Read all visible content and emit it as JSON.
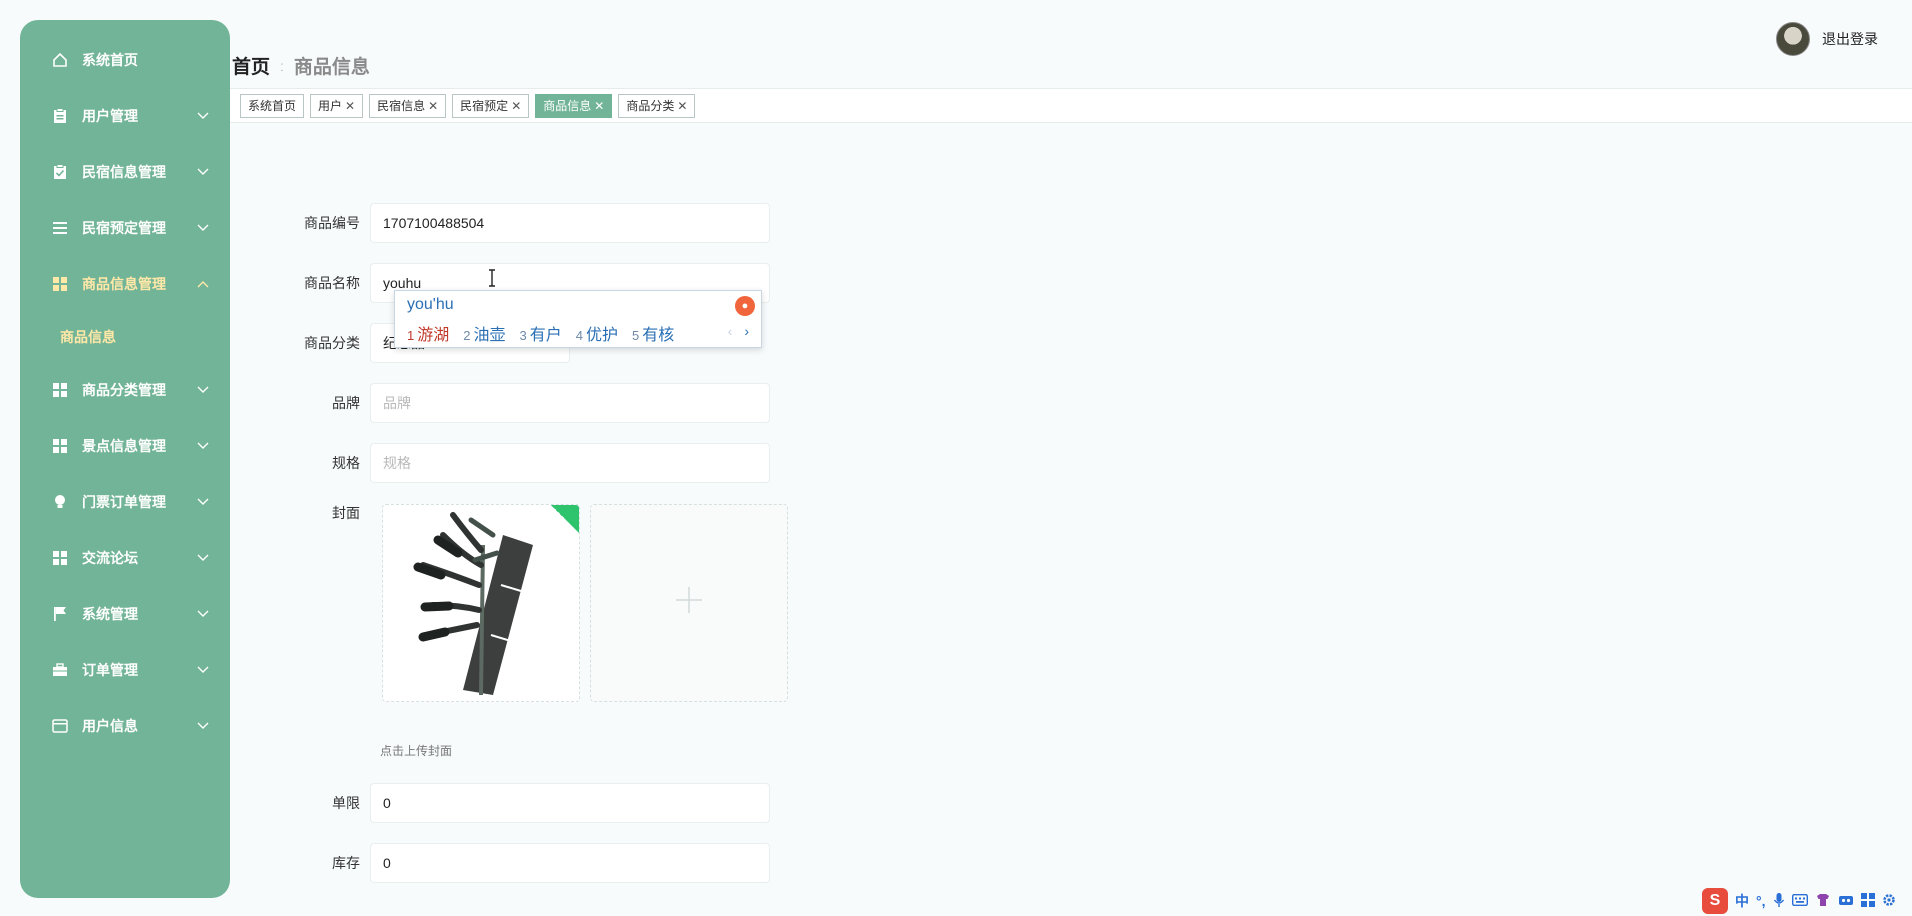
{
  "sidebar": {
    "items": [
      {
        "label": "系统首页",
        "icon": "home-icon",
        "has_children": false
      },
      {
        "label": "用户管理",
        "icon": "clipboard-icon",
        "has_children": true
      },
      {
        "label": "民宿信息管理",
        "icon": "clipboard-check-icon",
        "has_children": true
      },
      {
        "label": "民宿预定管理",
        "icon": "list-icon",
        "has_children": true
      },
      {
        "label": "商品信息管理",
        "icon": "grid-icon",
        "has_children": true,
        "expanded": true
      },
      {
        "label": "商品分类管理",
        "icon": "grid-icon",
        "has_children": true
      },
      {
        "label": "景点信息管理",
        "icon": "grid-icon",
        "has_children": true
      },
      {
        "label": "门票订单管理",
        "icon": "bulb-icon",
        "has_children": true
      },
      {
        "label": "交流论坛",
        "icon": "grid-icon",
        "has_children": true
      },
      {
        "label": "系统管理",
        "icon": "flag-icon",
        "has_children": true
      },
      {
        "label": "订单管理",
        "icon": "briefcase-icon",
        "has_children": true
      },
      {
        "label": "用户信息",
        "icon": "card-icon",
        "has_children": true
      }
    ],
    "submenu": {
      "label": "商品信息"
    }
  },
  "breadcrumb": {
    "home": "首页",
    "separator": "ː",
    "current": "商品信息"
  },
  "header": {
    "logout": "退出登录"
  },
  "tabs": [
    {
      "label": "系统首页",
      "closable": false,
      "active": false
    },
    {
      "label": "用户",
      "closable": true,
      "active": false
    },
    {
      "label": "民宿信息",
      "closable": true,
      "active": false
    },
    {
      "label": "民宿预定",
      "closable": true,
      "active": false
    },
    {
      "label": "商品信息",
      "closable": true,
      "active": true
    },
    {
      "label": "商品分类",
      "closable": true,
      "active": false
    }
  ],
  "tab_close": "✕",
  "form": {
    "code_label": "商品编号",
    "code_value": "1707100488504",
    "name_label": "商品名称",
    "name_value": "youhu",
    "category_label": "商品分类",
    "category_value": "纪念品",
    "brand_label": "品牌",
    "brand_placeholder": "品牌",
    "spec_label": "规格",
    "spec_placeholder": "规格",
    "cover_label": "封面",
    "cover_hint": "点击上传封面",
    "limit_label": "单限",
    "limit_value": "0",
    "stock_label": "库存",
    "stock_value": "0"
  },
  "ime": {
    "composition": "you'hu",
    "candidates": [
      {
        "num": "1",
        "text": "游湖"
      },
      {
        "num": "2",
        "text": "油壶"
      },
      {
        "num": "3",
        "text": "有户"
      },
      {
        "num": "4",
        "text": "优护"
      },
      {
        "num": "5",
        "text": "有核"
      }
    ],
    "prev": "‹",
    "next": "›"
  },
  "tray": {
    "logo": "S",
    "lang": "中",
    "punct": "°,"
  },
  "colors": {
    "sidebar": "#72b497",
    "active_tab": "#72b497",
    "submenu_text": "#ffe8a8"
  }
}
